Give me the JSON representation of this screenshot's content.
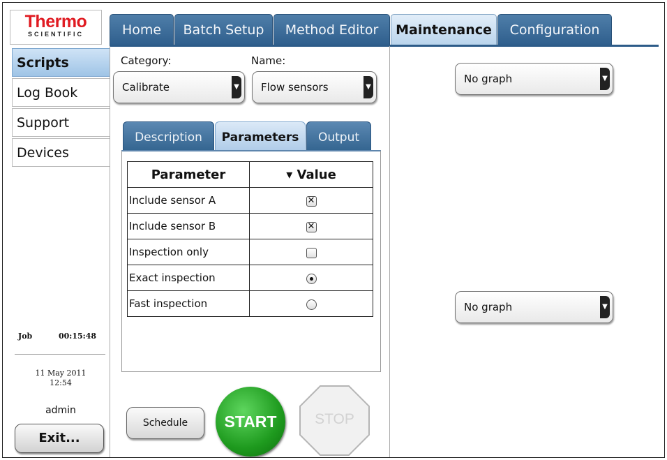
{
  "logo": {
    "main": "Thermo",
    "sub": "SCIENTIFIC"
  },
  "top_tabs": [
    {
      "label": "Home",
      "active": false
    },
    {
      "label": "Batch Setup",
      "active": false
    },
    {
      "label": "Method Editor",
      "active": false
    },
    {
      "label": "Maintenance",
      "active": true
    },
    {
      "label": "Configuration",
      "active": false
    }
  ],
  "sidebar": {
    "items": [
      {
        "label": "Scripts",
        "active": true
      },
      {
        "label": "Log Book",
        "active": false
      },
      {
        "label": "Support",
        "active": false
      },
      {
        "label": "Devices",
        "active": false
      }
    ],
    "job_label": "Job",
    "job_time": "00:15:48",
    "date": "11 May 2011",
    "time": "12:54",
    "user": "admin",
    "exit_label": "Exit..."
  },
  "form": {
    "category_label": "Category:",
    "category_value": "Calibrate",
    "name_label": "Name:",
    "name_value": "Flow sensors"
  },
  "sub_tabs": [
    {
      "label": "Description",
      "active": false
    },
    {
      "label": "Parameters",
      "active": true
    },
    {
      "label": "Output",
      "active": false
    }
  ],
  "params_table": {
    "col_parameter": "Parameter",
    "col_value": "▾ Value",
    "rows": [
      {
        "name": "Include sensor A",
        "control": "checkbox",
        "checked": true
      },
      {
        "name": "Include sensor B",
        "control": "checkbox",
        "checked": true
      },
      {
        "name": "Inspection only",
        "control": "checkbox",
        "checked": false
      },
      {
        "name": "Exact inspection",
        "control": "radio",
        "checked": true
      },
      {
        "name": "Fast inspection",
        "control": "radio",
        "checked": false
      }
    ]
  },
  "buttons": {
    "schedule": "Schedule",
    "start": "START",
    "stop": "STOP"
  },
  "graphs": {
    "top_value": "No graph",
    "bottom_value": "No graph"
  },
  "colors": {
    "brand_red": "#e01b22",
    "tab_blue": "#2f5f8d",
    "tab_active": "#b9d4ec",
    "start_green": "#1e9a1e"
  }
}
